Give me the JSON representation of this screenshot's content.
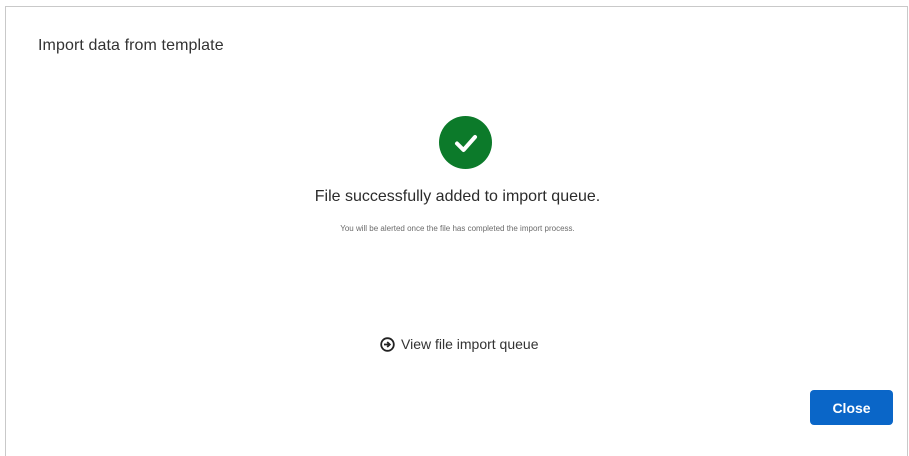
{
  "dialog": {
    "title": "Import data from template"
  },
  "status": {
    "icon": "check-circle-icon",
    "color": "#0c7a2a",
    "headline": "File successfully added to import queue.",
    "subtext": "You will be alerted once the file has completed the import process."
  },
  "link": {
    "icon": "arrow-circle-right-icon",
    "label": "View file import queue"
  },
  "footer": {
    "close_label": "Close",
    "accent": "#0a66c8"
  }
}
